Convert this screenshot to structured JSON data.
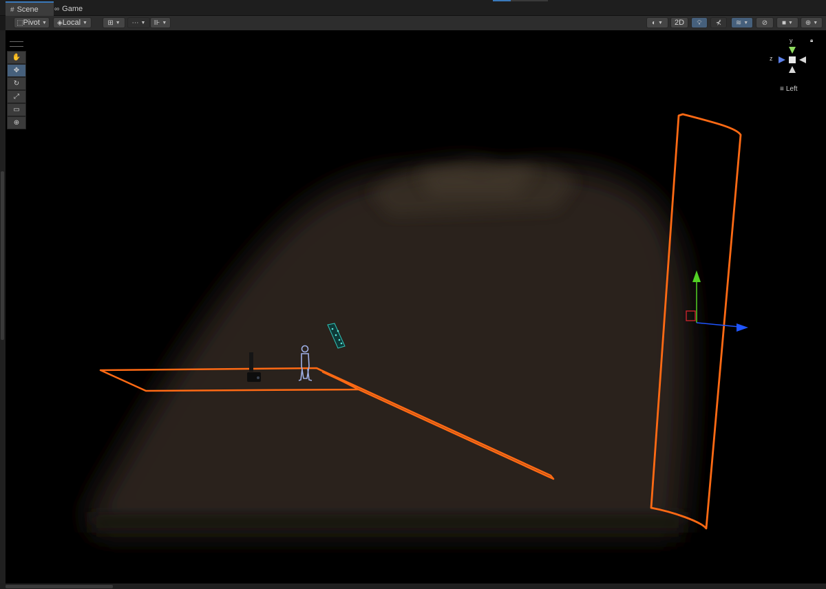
{
  "tabs": [
    {
      "label": "Scene",
      "icon": "grid-icon",
      "active": true
    },
    {
      "label": "Game",
      "icon": "gamepad-icon",
      "active": false
    }
  ],
  "toolbar": {
    "pivot_label": "Pivot",
    "space_label": "Local",
    "mode_2d_label": "2D"
  },
  "tools": [
    {
      "name": "hand-tool",
      "glyph": "✋",
      "active": false
    },
    {
      "name": "move-tool",
      "glyph": "✥",
      "active": true
    },
    {
      "name": "rotate-tool",
      "glyph": "↻",
      "active": false
    },
    {
      "name": "scale-tool",
      "glyph": "⤢",
      "active": false
    },
    {
      "name": "rect-tool",
      "glyph": "▭",
      "active": false
    },
    {
      "name": "transform-tool",
      "glyph": "⊕",
      "active": false
    }
  ],
  "gizmo": {
    "y_label": "y",
    "z_label": "z",
    "view_label": "Left"
  },
  "colors": {
    "selection_outline": "#ff6a14",
    "accent": "#3a79bb",
    "axis_x": "#c8242a",
    "axis_y": "#52d124",
    "axis_z": "#1f55ff"
  }
}
